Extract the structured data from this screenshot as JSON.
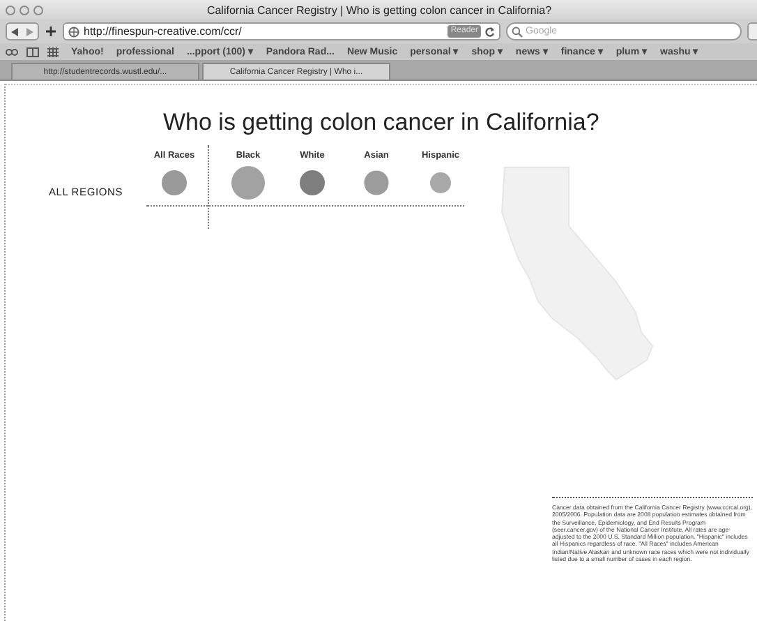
{
  "window": {
    "title": "California Cancer Registry | Who is getting colon cancer in California?"
  },
  "toolbar": {
    "url": "http://finespun-creative.com/ccr/",
    "reader": "Reader",
    "search": {
      "placeholder": "Google"
    }
  },
  "bookmarks": [
    {
      "label": "Yahoo!"
    },
    {
      "label": "professional"
    },
    {
      "label": "...pport (100) ▾"
    },
    {
      "label": "Pandora Rad..."
    },
    {
      "label": "New Music"
    },
    {
      "label": "personal ▾"
    },
    {
      "label": "shop ▾"
    },
    {
      "label": "news ▾"
    },
    {
      "label": "finance ▾"
    },
    {
      "label": "plum ▾"
    },
    {
      "label": "washu ▾"
    }
  ],
  "tabs": [
    {
      "label": "http://studentrecords.wustl.edu/...",
      "selected": false
    },
    {
      "label": "California Cancer Registry | Who i...",
      "selected": true
    }
  ],
  "page": {
    "heading": "Who is getting colon cancer in California?",
    "region": "ALL REGIONS",
    "races": [
      {
        "label": "All Races",
        "color": "#9a9a9a"
      },
      {
        "label": "Black",
        "color": "#a2a2a2"
      },
      {
        "label": "White",
        "color": "#7e7e7e"
      },
      {
        "label": "Asian",
        "color": "#9c9c9c"
      },
      {
        "label": "Hispanic",
        "color": "#a8a8a8"
      }
    ],
    "footnote": "Cancer data obtained from the California Cancer Registry (www.ccrcal.org), 2005/2006. Population data are 2008 population estimates obtained from the Surveillance, Epidemiology, and End Results Program (seer.cancer.gov) of the National Cancer Institute. All rates are age-adjusted to the 2000 U.S. Standard Million population. \"Hispanic\" includes all Hispanics regardless of race. \"All Races\" includes American Indian/Native Alaskan and unknown race races which were not individually listed due to a small number of cases in each region."
  }
}
